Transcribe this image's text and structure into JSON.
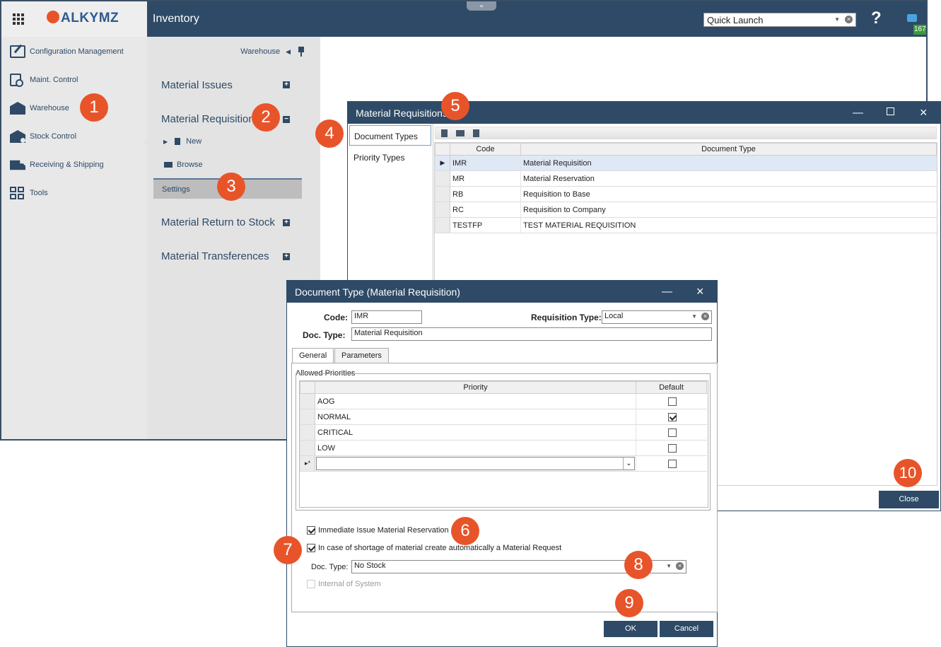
{
  "app": {
    "brand": "ALKYMZ",
    "title": "Inventory",
    "quick_launch": "Quick Launch",
    "help": "?",
    "notifications": "167"
  },
  "sidebar": {
    "items": [
      {
        "label": "Configuration Management",
        "icon": "edit-icon"
      },
      {
        "label": "Maint. Control",
        "icon": "clipboard-search-icon"
      },
      {
        "label": "Warehouse",
        "icon": "warehouse-icon"
      },
      {
        "label": "Stock Control",
        "icon": "stock-search-icon"
      },
      {
        "label": "Receiving & Shipping",
        "icon": "truck-icon"
      },
      {
        "label": "Tools",
        "icon": "tools-grid-icon"
      }
    ]
  },
  "subnav": {
    "header": "Warehouse",
    "sections": [
      "Material Issues",
      "Material Requisitions",
      "Material Return to Stock",
      "Material Transferences"
    ],
    "new": "New",
    "browse": "Browse",
    "settings": "Settings"
  },
  "mr_window": {
    "title": "Material Requisitions",
    "tabs": [
      "Document Types",
      "Priority Types"
    ],
    "columns": [
      "Code",
      "Document Type"
    ],
    "rows": [
      {
        "code": "IMR",
        "type": "Material Requisition"
      },
      {
        "code": "MR",
        "type": "Material Reservation"
      },
      {
        "code": "RB",
        "type": "Requisition to Base"
      },
      {
        "code": "RC",
        "type": "Requisition to Company"
      },
      {
        "code": "TESTFP",
        "type": "TEST MATERIAL REQUISITION"
      }
    ],
    "close": "Close"
  },
  "dt_dialog": {
    "title": "Document Type (Material Requisition)",
    "code_label": "Code:",
    "code_value": "IMR",
    "req_type_label": "Requisition Type:",
    "req_type_value": "Local",
    "doc_type_label": "Doc. Type:",
    "doc_type_value": "Material Requisition",
    "tabs": [
      "General",
      "Parameters"
    ],
    "allowed_title": "Allowed Priorities",
    "columns": [
      "Priority",
      "Default"
    ],
    "priorities": [
      {
        "name": "AOG",
        "default": false
      },
      {
        "name": "NORMAL",
        "default": true
      },
      {
        "name": "CRITICAL",
        "default": false
      },
      {
        "name": "LOW",
        "default": false
      }
    ],
    "new_row_marker": "▸*",
    "immediate_issue": "Immediate Issue Material Reservation",
    "shortage": "In case of shortage of material create automatically a Material Request",
    "doc_type2_label": "Doc. Type:",
    "doc_type2_value": "No Stock",
    "internal": "Internal of System",
    "ok": "OK",
    "cancel": "Cancel"
  },
  "callouts": [
    "1",
    "2",
    "3",
    "4",
    "5",
    "6",
    "7",
    "8",
    "9",
    "10"
  ],
  "colors": {
    "accent": "#2e4a66",
    "callout": "#e8542a"
  }
}
